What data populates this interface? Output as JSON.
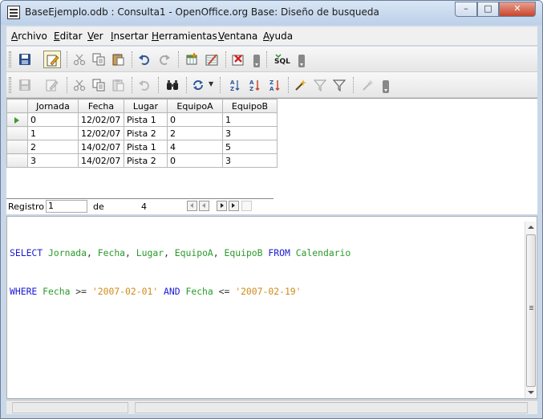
{
  "window": {
    "title": "BaseEjemplo.odb : Consulta1 - OpenOffice.org Base: Diseño de busqueda",
    "controls": {
      "minimize": "–",
      "maximize": "□",
      "close": "✕"
    }
  },
  "menubar": [
    {
      "first": "A",
      "rest": "rchivo"
    },
    {
      "first": "E",
      "rest": "ditar"
    },
    {
      "first": "V",
      "rest": "er"
    },
    {
      "first": "I",
      "rest": "nsertar"
    },
    {
      "first": "H",
      "rest": "erramientas"
    },
    {
      "first": "V",
      "rest": "entana"
    },
    {
      "first": "A",
      "rest": "yuda"
    }
  ],
  "toolbar1": {
    "icons": [
      "save-icon",
      "edit-mode-icon",
      "cut-icon",
      "copy-icon",
      "paste-icon",
      "undo-icon",
      "redo-icon",
      "add-table-icon",
      "design-view-icon",
      "clear-query-icon",
      "sql-icon"
    ],
    "sql_label": "SQL"
  },
  "toolbar2": {
    "icons": [
      "save-record-icon",
      "edit-data-icon",
      "cut-icon",
      "copy-icon",
      "paste-icon",
      "undo-icon",
      "find-record-icon",
      "refresh-icon",
      "sort-ascending-icon",
      "sort-descending-icon",
      "sort-icon",
      "autofilter-icon",
      "standard-filter-icon",
      "apply-filter-icon",
      "remove-filter-icon"
    ]
  },
  "grid": {
    "columns": [
      "Jornada",
      "Fecha",
      "Lugar",
      "EquipoA",
      "EquipoB"
    ],
    "rows": [
      [
        "0",
        "12/02/07",
        "Pista 1",
        "0",
        "1"
      ],
      [
        "1",
        "12/02/07",
        "Pista 2",
        "2",
        "3"
      ],
      [
        "2",
        "14/02/07",
        "Pista 1",
        "4",
        "5"
      ],
      [
        "3",
        "14/02/07",
        "Pista 2",
        "0",
        "3"
      ]
    ],
    "current_row": 0
  },
  "navigation": {
    "record_label": "Registro",
    "record_value": "1",
    "of_label": "de",
    "total": "4"
  },
  "sql": {
    "line1": [
      {
        "t": "SELECT",
        "c": "kw"
      },
      {
        "t": " ",
        "c": "op"
      },
      {
        "t": "Jornada",
        "c": "id"
      },
      {
        "t": ", ",
        "c": "op"
      },
      {
        "t": "Fecha",
        "c": "id"
      },
      {
        "t": ", ",
        "c": "op"
      },
      {
        "t": "Lugar",
        "c": "id"
      },
      {
        "t": ", ",
        "c": "op"
      },
      {
        "t": "EquipoA",
        "c": "id"
      },
      {
        "t": ", ",
        "c": "op"
      },
      {
        "t": "EquipoB",
        "c": "id"
      },
      {
        "t": " ",
        "c": "op"
      },
      {
        "t": "FROM",
        "c": "kw"
      },
      {
        "t": " ",
        "c": "op"
      },
      {
        "t": "Calendario",
        "c": "id"
      }
    ],
    "line2": [
      {
        "t": "WHERE",
        "c": "kw"
      },
      {
        "t": " ",
        "c": "op"
      },
      {
        "t": "Fecha",
        "c": "id"
      },
      {
        "t": " >= ",
        "c": "op"
      },
      {
        "t": "'2007-02-01'",
        "c": "str"
      },
      {
        "t": " ",
        "c": "op"
      },
      {
        "t": "AND",
        "c": "kw"
      },
      {
        "t": " ",
        "c": "op"
      },
      {
        "t": "Fecha",
        "c": "id"
      },
      {
        "t": " <= ",
        "c": "op"
      },
      {
        "t": "'2007-02-19'",
        "c": "str"
      }
    ]
  }
}
